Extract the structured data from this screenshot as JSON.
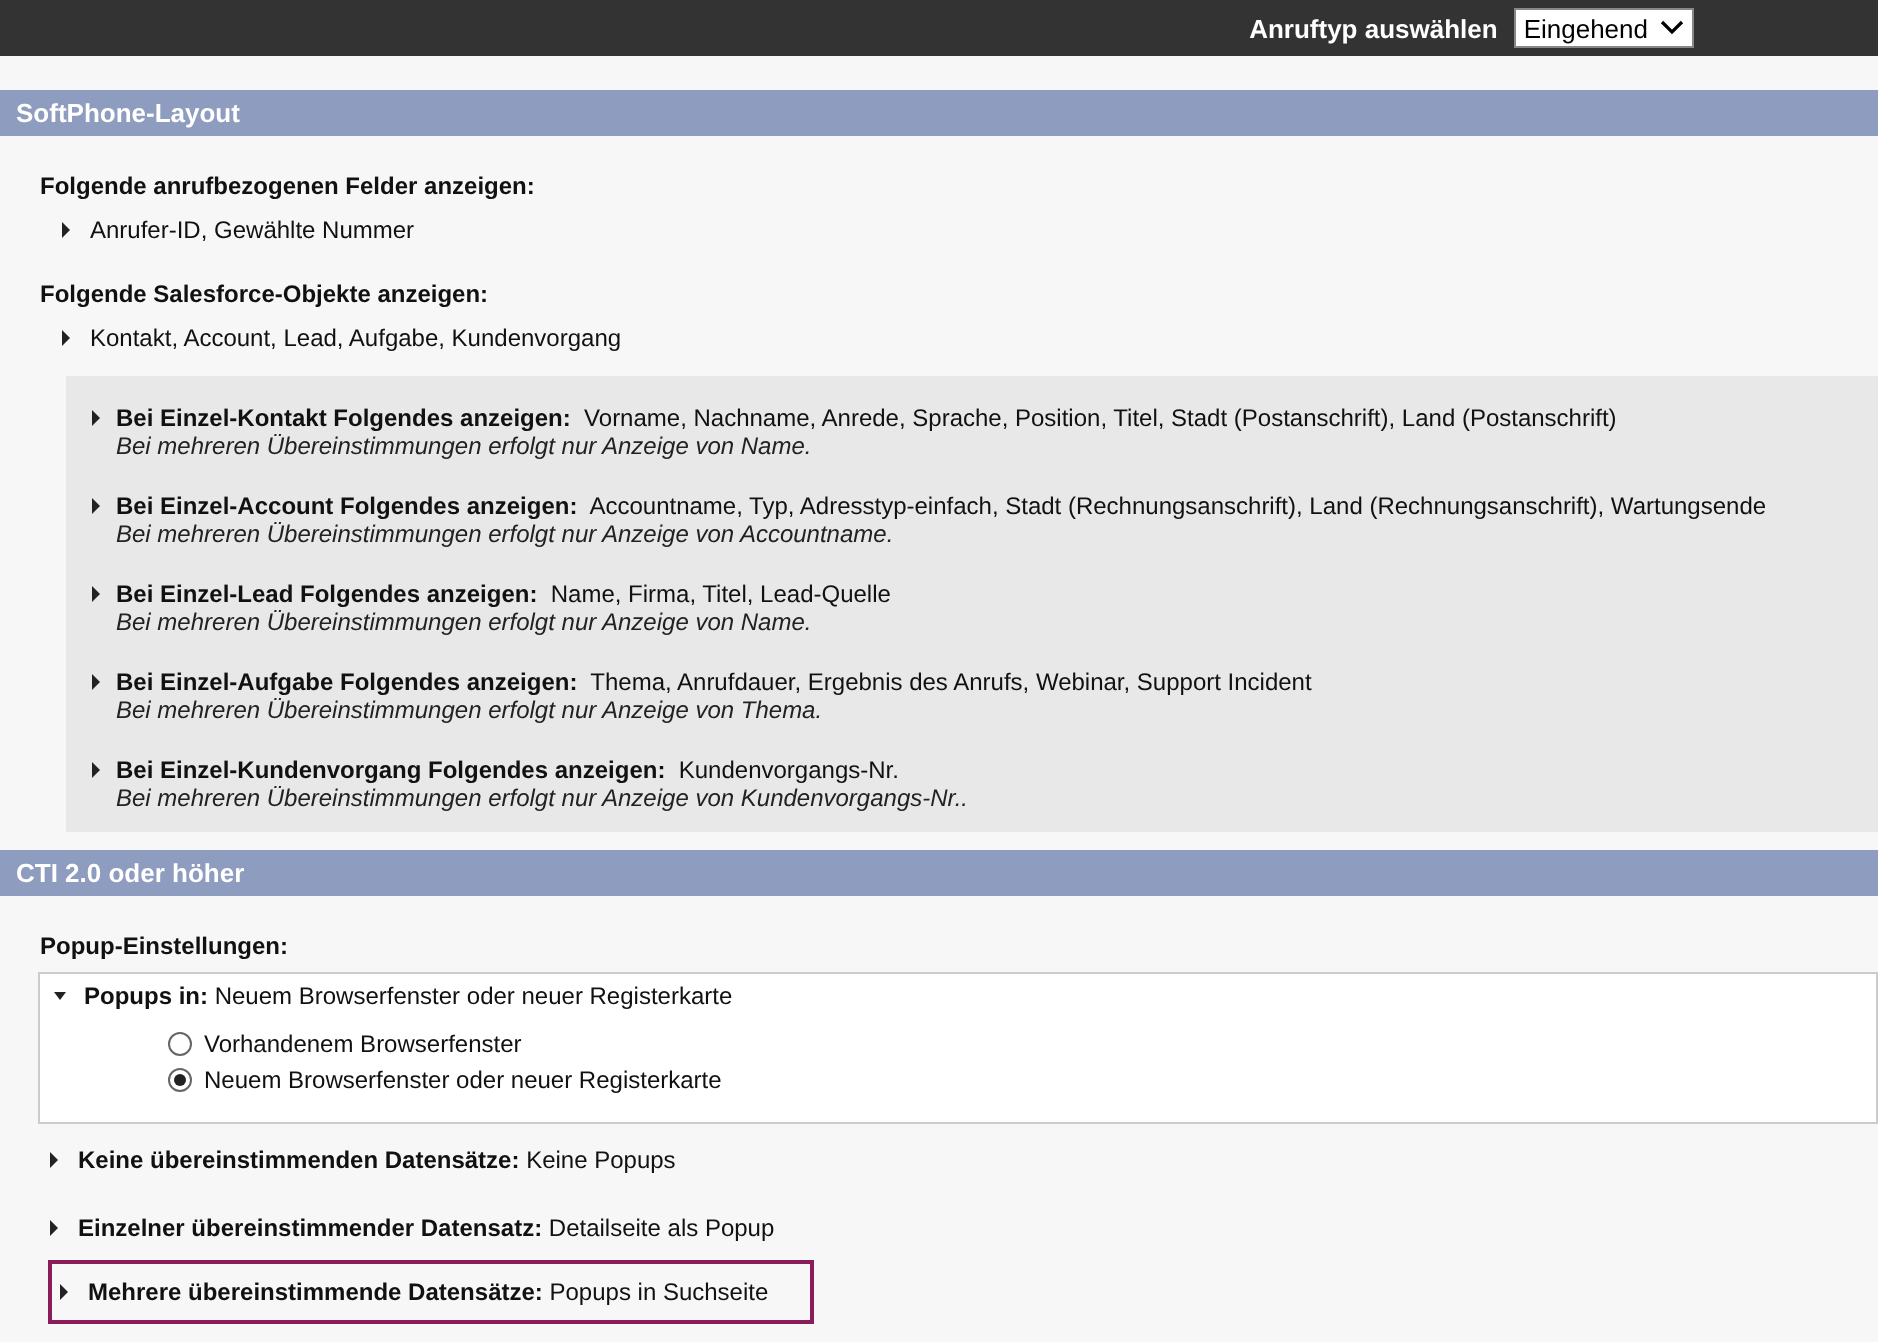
{
  "top_bar": {
    "label": "Anruftyp auswählen",
    "select": {
      "value": "Eingehend"
    }
  },
  "softphone_layout": {
    "title": "SoftPhone-Layout",
    "groups": [
      {
        "heading": "Folgende anrufbezogenen Felder anzeigen:",
        "items": [
          {
            "text": "Anrufer-ID, Gewählte Nummer",
            "expanded": false
          }
        ]
      },
      {
        "heading": "Folgende Salesforce-Objekte anzeigen:",
        "items": [
          {
            "text": "Kontakt, Account, Lead, Aufgabe, Kundenvorgang",
            "expanded": false
          }
        ]
      }
    ],
    "details": [
      {
        "label": "Bei Einzel-Kontakt Folgendes anzeigen:",
        "value": "Vorname, Nachname, Anrede, Sprache, Position, Titel, Stadt (Postanschrift), Land (Postanschrift)",
        "note": "Bei mehreren Übereinstimmungen erfolgt nur Anzeige von Name.",
        "expanded": false
      },
      {
        "label": "Bei Einzel-Account Folgendes anzeigen:",
        "value": "Accountname, Typ, Adresstyp-einfach, Stadt (Rechnungsanschrift), Land (Rechnungsanschrift), Wartungsende",
        "note": "Bei mehreren Übereinstimmungen erfolgt nur Anzeige von Accountname.",
        "expanded": false
      },
      {
        "label": "Bei Einzel-Lead Folgendes anzeigen:",
        "value": "Name, Firma, Titel, Lead-Quelle",
        "note": "Bei mehreren Übereinstimmungen erfolgt nur Anzeige von Name.",
        "expanded": false
      },
      {
        "label": "Bei Einzel-Aufgabe Folgendes anzeigen:",
        "value": "Thema, Anrufdauer, Ergebnis des Anrufs, Webinar, Support Incident",
        "note": "Bei mehreren Übereinstimmungen erfolgt nur Anzeige von Thema.",
        "expanded": false
      },
      {
        "label": "Bei Einzel-Kundenvorgang Folgendes anzeigen:",
        "value": "Kundenvorgangs-Nr.",
        "note": "Bei mehreren Übereinstimmungen erfolgt nur Anzeige von Kundenvorgangs-Nr..",
        "expanded": false
      }
    ]
  },
  "cti": {
    "title": "CTI 2.0 oder höher",
    "heading": "Popup-Einstellungen:",
    "options": [
      {
        "label": "Popups in:",
        "value": "Neuem Browserfenster oder neuer Registerkarte",
        "expanded": true,
        "highlighted": false,
        "choices": [
          {
            "label": "Vorhandenem Browserfenster",
            "selected": false
          },
          {
            "label": "Neuem Browserfenster oder neuer Registerkarte",
            "selected": true
          }
        ]
      },
      {
        "label": "Keine übereinstimmenden Datensätze:",
        "value": "Keine Popups",
        "expanded": false,
        "highlighted": false
      },
      {
        "label": "Einzelner übereinstimmender Datensatz:",
        "value": "Detailseite als Popup",
        "expanded": false,
        "highlighted": false
      },
      {
        "label": "Mehrere übereinstimmende Datensätze:",
        "value": "Popups in Suchseite",
        "expanded": false,
        "highlighted": true
      }
    ]
  }
}
